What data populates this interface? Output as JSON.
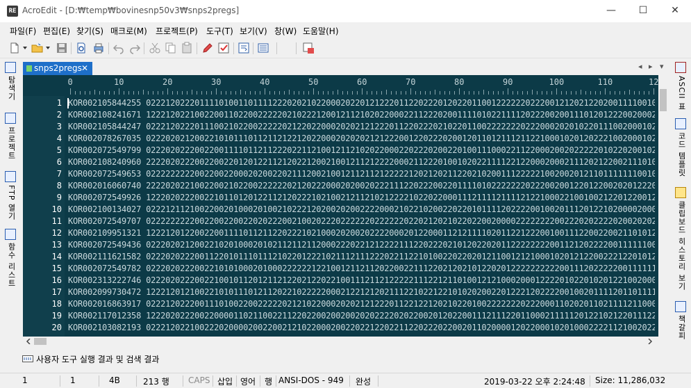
{
  "window": {
    "app_name": "AcroEdit",
    "path": " - [D:₩temp₩bovinesnp50v3₩snps2pregs]",
    "app_icon_text": "RE",
    "minimize": "—",
    "maximize": "☐",
    "close": "✕"
  },
  "menu": [
    "파일(F)",
    "편집(E)",
    "찾기(S)",
    "매크로(M)",
    "프로젝트(P)",
    "도구(T)",
    "보기(V)",
    "창(W)",
    "도움말(H)"
  ],
  "tab": {
    "label": "snps2pregs",
    "close": "✕"
  },
  "tab_nav": {
    "prev": "◂",
    "next": "▸",
    "list": "▾"
  },
  "left_panel": [
    {
      "label": "탐색기",
      "icon": "explorer-icon"
    },
    {
      "label": "프로젝트",
      "icon": "project-icon"
    },
    {
      "label": "FTP 열기",
      "icon": "ftp-icon"
    },
    {
      "label": "함수 리스트",
      "icon": "function-list-icon"
    }
  ],
  "right_panel": [
    {
      "label": "ASCII 표",
      "icon": "ascii-table-icon"
    },
    {
      "label": "코드 템플릿",
      "icon": "code-template-icon"
    },
    {
      "label": "클립보드 히스토리 보기",
      "icon": "clipboard-history-icon"
    },
    {
      "label": "책갈피",
      "icon": "bookmark-icon"
    }
  ],
  "ruler_labels": [
    "0",
    "10",
    "20",
    "30",
    "40",
    "50",
    "60",
    "70",
    "80",
    "90",
    "100",
    "110",
    "12"
  ],
  "lines": [
    {
      "no": "1",
      "text": "KOR002105844255 02221202220111101001101111222020210220002022012122201122022201202201100122222202220012120212202001111001010"
    },
    {
      "no": "2",
      "text": "KOR002108241671 12221202210022001102200222220210222120012112102022000221122202001111010221111202220020011101201222002000211"
    },
    {
      "no": "3",
      "text": "KOR002105844247 02221202220111002102200222220212202200020202121222011220222021022011002222222022200020201022011100200010222"
    },
    {
      "no": "4",
      "text": "KOR002078267035 02220202120022101011101121121221202200020202021212220012202220200120110121112112210001020120222100200010202"
    },
    {
      "no": "5",
      "text": "KOR002072549799 02220202220022001111011211222022112100121121020220002202220200220100111000221122000200202222201022020010222"
    },
    {
      "no": "6",
      "text": "KOR002108240960 22220202220022002201201221121202212002100121121222200021122201001020221111221220002000211120212200211101022"
    },
    {
      "no": "7",
      "text": "KOR002072549653 02222222220022002200020200220211120021001211211212222212021202112202102001112222210020020121101111111001011"
    },
    {
      "no": "8",
      "text": "KOR002016060740 22220202210022002102200222222021202220002020020222111220222002201111010222222202220020012201220020201222001"
    },
    {
      "no": "9",
      "text": "KOR002072549926 12220202220022101101201221121202221021002121121021222210220220001112111121111212210002210010021220122001201"
    },
    {
      "no": "10",
      "text": "KOR002100134027 02221211210022002010002010021022212020020200222200021022102002202201011112022220010020111201221020000200001"
    },
    {
      "no": "11",
      "text": "KOR002072549707 02222222220022002200220202220021002022202222220222222022021202102202200200002222222200222020222202002020222"
    },
    {
      "no": "12",
      "text": "KOR002109951321 12221201220022001111011211220222102100020200202222000201220001121211110201122122200100111220022002110101211"
    },
    {
      "no": "13",
      "text": "KOR002072549436 02220202120022102010002010211211211200022202212122221112202220210120220201122222222001121202222001111110011"
    },
    {
      "no": "14",
      "text": "KOR002111621582 02220202220011220101110111210220122210211121112220221122101002202202012110012121000102012122002221220101222"
    },
    {
      "no": "15",
      "text": "KOR002072549782 02220202220022101010002010002222221221001211211202200221112202120210122020122222222220011120222220011111100202"
    },
    {
      "no": "16",
      "text": "KOR002313222746 02220202220022100101120121121220212202210011121121222221112212110100121210002000122220102201020122100200012"
    },
    {
      "no": "17",
      "text": "KOR002099730472 12221201210022101011101211202210222220002122121202111221022122101020200220122212022220010020111120110111101"
    },
    {
      "no": "18",
      "text": "KOR002016863917 02221202220011101002200222220212102200020202121222011221221202102201002222222022200011020201102111121100012"
    },
    {
      "no": "19",
      "text": "KOR002117012358 12220202220022000011021100221122022002002002020222202022002012022001112111220110002111112012210212201112222"
    },
    {
      "no": "20",
      "text": "KOR002103082193 02221202210022202000020022002121022000200220221220221122022202200201102000012022000102010002222112100202222"
    }
  ],
  "output_panel": {
    "label": "사용자 도구 실행 결과 및 검색 결과"
  },
  "status": {
    "line": "1",
    "column": "1",
    "char_code": "4B",
    "line_count": "213 행",
    "caps": "CAPS",
    "insert_mode": "삽입",
    "lang": "영어",
    "wrap": "행",
    "encoding": "ANSI-DOS - 949",
    "composition": "완성",
    "datetime": "2019-03-22 오후 2:24:48",
    "size": "Size: 11,286,032"
  },
  "colors": {
    "editor_bg": "#0c3a47",
    "gutter_bg": "#103f4c",
    "tab_active": "#1e6fc9",
    "text": "#c8d8dc"
  }
}
